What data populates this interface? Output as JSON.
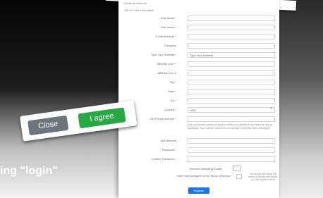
{
  "dialog": {
    "close_label": "Close",
    "agree_label": "I agree"
  },
  "caption": "ing \"login\"",
  "form": {
    "page_title": "Create an Account",
    "section_heading": "Tell Us Your Information",
    "fields": [
      {
        "label": "First Name *",
        "value": ""
      },
      {
        "label": "Last Name *",
        "value": ""
      },
      {
        "label": "E-Mail Address *",
        "value": ""
      },
      {
        "label": "Company",
        "value": ""
      },
      {
        "label": "Type Your Address *",
        "value": "Type Your Address"
      },
      {
        "label": "Address Line **",
        "value": ""
      },
      {
        "label": "Address Line 2",
        "value": ""
      },
      {
        "label": "City *",
        "value": ""
      },
      {
        "label": "State *",
        "value": ""
      },
      {
        "label": "Zip *",
        "value": ""
      },
      {
        "label": "Country *",
        "value": "USA"
      },
      {
        "label": "Cell Phone Number *",
        "value": ""
      }
    ],
    "cell_notice": "Your cell phone number is used to verify your identity if you lose your key or password. Your number must be a US number to receive SMS messages.",
    "fields2": [
      {
        "label": "Site Address",
        "value": ""
      },
      {
        "label": "Password *",
        "value": ""
      },
      {
        "label": "Confirm Password *",
        "value": ""
      }
    ],
    "marketing_label": "Receive Marketing Emails",
    "terms_label": "I have read and agree to the Terms of Service *",
    "terms_note": "You should first study the terms of Service link before you can agree to them",
    "register_label": "Register"
  },
  "colors": {
    "agree": "#28a745",
    "close": "#6c757d",
    "register": "#1a73e8"
  }
}
